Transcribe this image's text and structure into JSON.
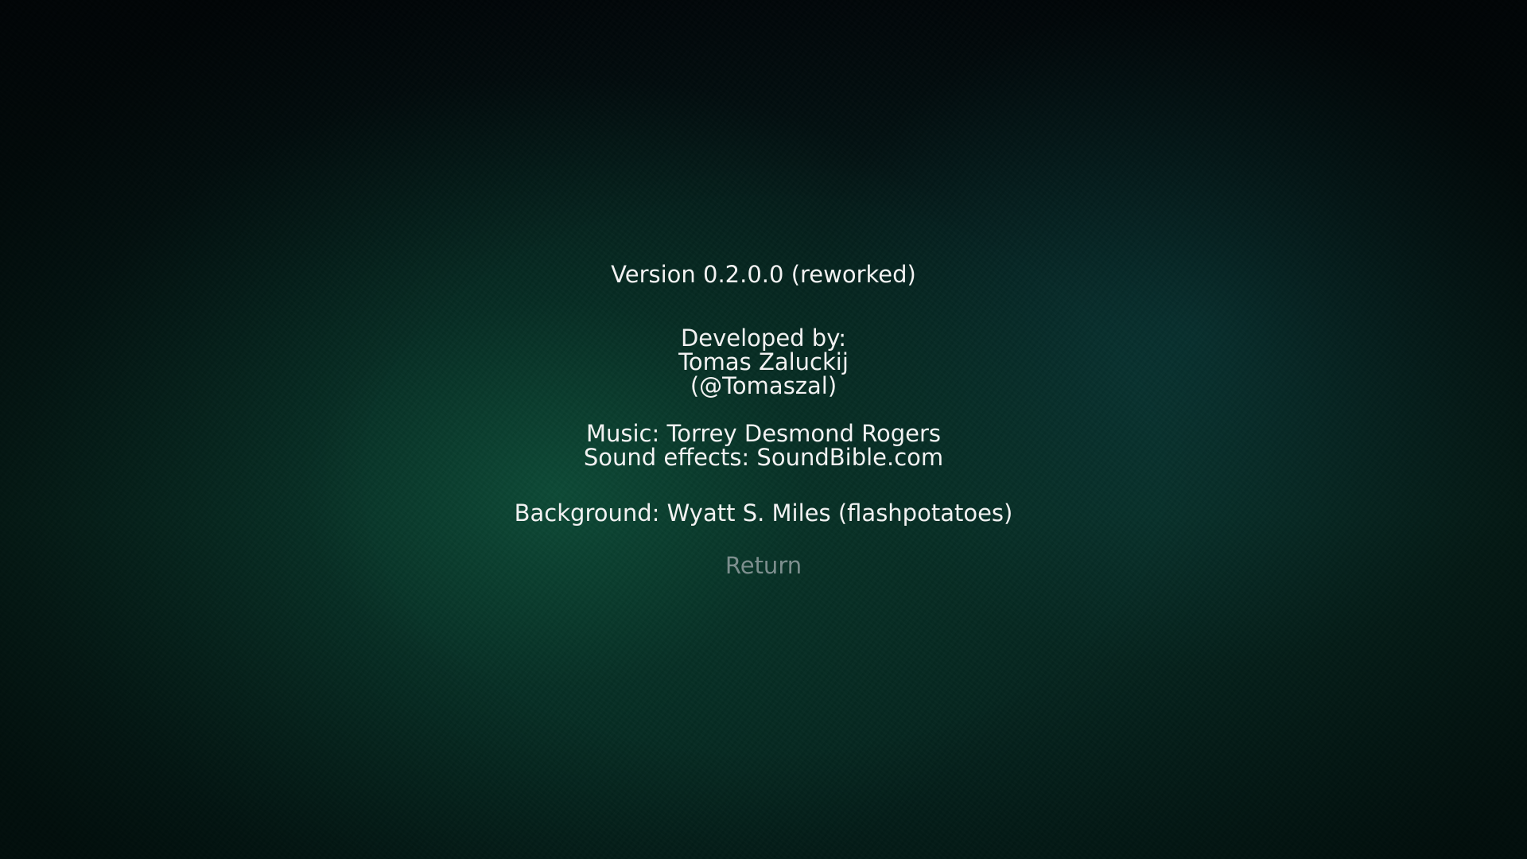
{
  "credits": {
    "version": "Version 0.2.0.0 (reworked)",
    "developed_by_label": "Developed by:",
    "developer_name": "Tomas Zaluckij",
    "developer_handle": "(@Tomaszal)",
    "music": "Music: Torrey Desmond Rogers",
    "sound_effects": "Sound effects: SoundBible.com",
    "background": "Background: Wyatt S. Miles (flashpotatoes)"
  },
  "menu": {
    "return_label": "Return"
  },
  "colors": {
    "text": "#f2f2f2",
    "inactive_menu_text": "#7d8f8e",
    "background_dark": "#04150f",
    "background_accent": "#0e503a"
  }
}
